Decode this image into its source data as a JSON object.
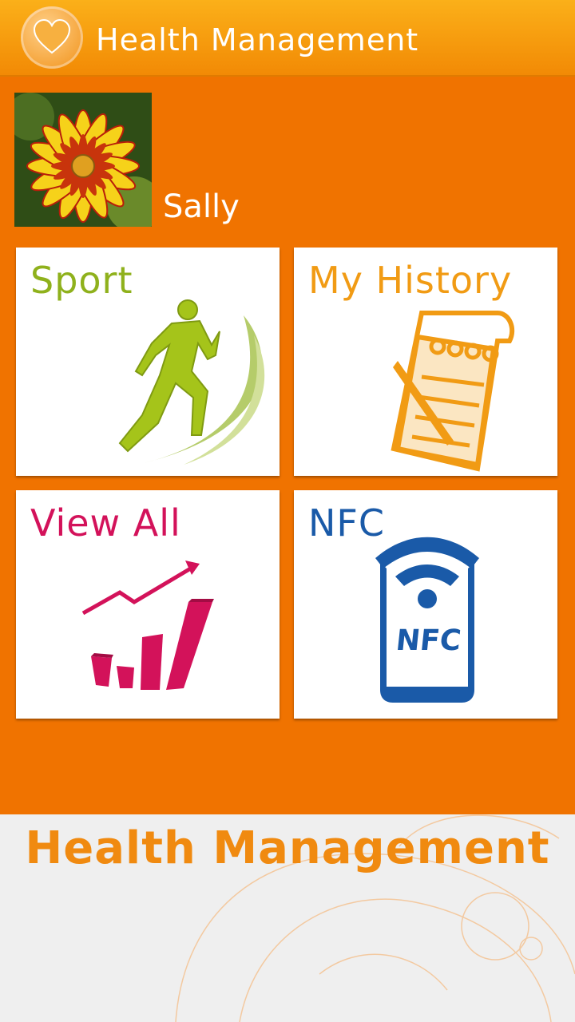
{
  "header": {
    "title": "Health Management",
    "icon": "heart-icon"
  },
  "profile": {
    "name": "Sally"
  },
  "tiles": [
    {
      "label": "Sport",
      "color": "#8fb11c",
      "icon": "runner-icon"
    },
    {
      "label": "My History",
      "color": "#f19b14",
      "icon": "notepad-icon"
    },
    {
      "label": "View All",
      "color": "#d3125a",
      "icon": "bar-chart-icon"
    },
    {
      "label": "NFC",
      "color": "#1a5aa8",
      "icon": "nfc-phone-icon",
      "badge": "NFC"
    }
  ],
  "footer": {
    "title": "Health Management"
  },
  "colors": {
    "primary": "#f07300",
    "header": "#f59a10"
  }
}
